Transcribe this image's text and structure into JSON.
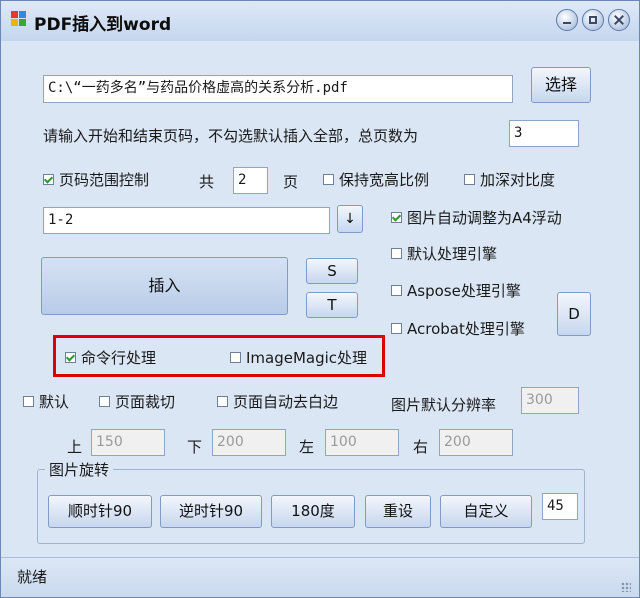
{
  "window": {
    "title": "PDF插入到word"
  },
  "file": {
    "path": "C:\\“一药多名”与药品价格虚高的关系分析.pdf",
    "select_label": "选择"
  },
  "pages": {
    "prompt": "请输入开始和结束页码，不勾选默认插入全部，总页数为",
    "total": "3"
  },
  "range": {
    "control_label": "页码范围控制",
    "control_checked": true,
    "gong": "共",
    "count": "2",
    "ye": "页",
    "value": "1-2",
    "down_arrow": "↓"
  },
  "options": {
    "keep_ratio": {
      "label": "保持宽高比例",
      "checked": false
    },
    "contrast": {
      "label": "加深对比度",
      "checked": false
    },
    "auto_a4": {
      "label": "图片自动调整为A4浮动",
      "checked": true
    },
    "default_engine": {
      "label": "默认处理引擎",
      "checked": false
    },
    "aspose": {
      "label": "Aspose处理引擎",
      "checked": false
    },
    "acrobat": {
      "label": "Acrobat处理引擎",
      "checked": false
    },
    "cmdline": {
      "label": "命令行处理",
      "checked": true
    },
    "imagemagick": {
      "label": "ImageMagic处理",
      "checked": false
    },
    "default_crop": {
      "label": "默认",
      "checked": false
    },
    "page_crop": {
      "label": "页面裁切",
      "checked": false
    },
    "auto_trim": {
      "label": "页面自动去白边",
      "checked": false
    }
  },
  "buttons": {
    "insert": "插入",
    "s": "S",
    "t": "T",
    "d": "D"
  },
  "resolution": {
    "label": "图片默认分辨率",
    "value": "300"
  },
  "margins": {
    "top_label": "上",
    "top": "150",
    "bottom_label": "下",
    "bottom": "200",
    "left_label": "左",
    "left": "100",
    "right_label": "右",
    "right": "200"
  },
  "rotation": {
    "group_label": "图片旋转",
    "cw90": "顺时针90",
    "ccw90": "逆时针90",
    "r180": "180度",
    "reset": "重设",
    "custom": "自定义",
    "custom_value": "45"
  },
  "status": {
    "text": "就绪"
  }
}
